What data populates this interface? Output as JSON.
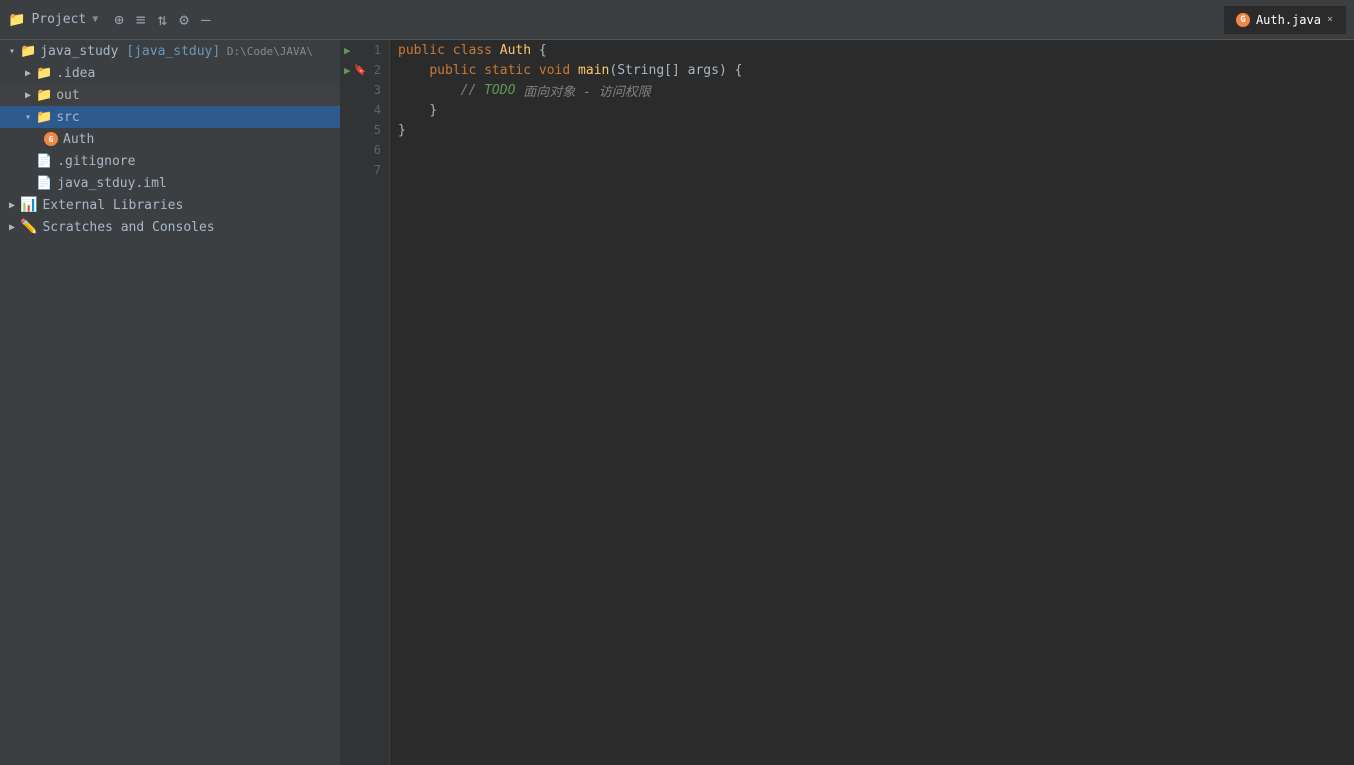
{
  "titlebar": {
    "project_label": "Project",
    "dropdown_arrow": "▼",
    "icons": [
      "⊕",
      "≡",
      "⇅",
      "⚙",
      "—"
    ],
    "tab_label": "Auth.java",
    "tab_close": "×"
  },
  "sidebar": {
    "items": [
      {
        "id": "java_study",
        "label": "java_study [java_stduy]",
        "sublabel": "D:\\Code\\JAVA\\",
        "indent": 0,
        "type": "project",
        "expanded": true,
        "arrow": "▾"
      },
      {
        "id": "idea",
        "label": ".idea",
        "indent": 1,
        "type": "folder",
        "expanded": false,
        "arrow": "▶"
      },
      {
        "id": "out",
        "label": "out",
        "indent": 1,
        "type": "folder-out",
        "expanded": false,
        "arrow": "▶"
      },
      {
        "id": "src",
        "label": "src",
        "indent": 1,
        "type": "folder-src",
        "expanded": true,
        "arrow": "▾",
        "selected": false
      },
      {
        "id": "Auth",
        "label": "Auth",
        "indent": 2,
        "type": "java",
        "arrow": ""
      },
      {
        "id": "gitignore",
        "label": ".gitignore",
        "indent": 1,
        "type": "file",
        "arrow": ""
      },
      {
        "id": "iml",
        "label": "java_stduy.iml",
        "indent": 1,
        "type": "file",
        "arrow": ""
      },
      {
        "id": "extlib",
        "label": "External Libraries",
        "indent": 0,
        "type": "extlib",
        "expanded": false,
        "arrow": "▶"
      },
      {
        "id": "scratches",
        "label": "Scratches and Consoles",
        "indent": 0,
        "type": "scratches",
        "expanded": false,
        "arrow": "▶"
      }
    ]
  },
  "editor": {
    "filename": "Auth.java",
    "lines": [
      {
        "num": 1,
        "run": true,
        "bookmark": false,
        "code": "public class Auth {"
      },
      {
        "num": 2,
        "run": true,
        "bookmark": true,
        "code": "    public static void main(String[] args) {"
      },
      {
        "num": 3,
        "run": false,
        "bookmark": false,
        "code": "        // TODO 面向对象 - 访问权限"
      },
      {
        "num": 4,
        "run": false,
        "bookmark": false,
        "code": "    }"
      },
      {
        "num": 5,
        "run": false,
        "bookmark": false,
        "code": "}"
      },
      {
        "num": 6,
        "run": false,
        "bookmark": false,
        "code": ""
      },
      {
        "num": 7,
        "run": false,
        "bookmark": false,
        "code": ""
      }
    ]
  }
}
